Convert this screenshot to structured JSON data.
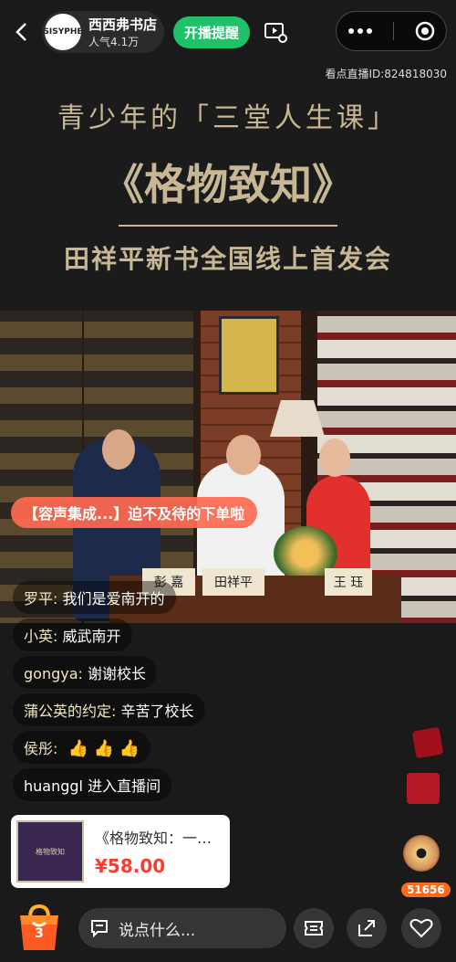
{
  "header": {
    "host_name": "西西弗书店",
    "host_popularity": "人气4.1万",
    "avatar_text": "SISYPHE",
    "notify_label": "开播提醒",
    "room_id": "看点直播ID:824818030"
  },
  "banner": {
    "line1": "青少年的「三堂人生课」",
    "line2": "《格物致知》",
    "line3": "田祥平新书全国线上首发会"
  },
  "scene": {
    "plate_left": "彭 嘉",
    "plate_center": "田祥平",
    "plate_right": "王 珏"
  },
  "promo": {
    "text": "【容声集成...】迫不及待的下单啦"
  },
  "comments": [
    {
      "name": "罗平:",
      "text": "我们是爱南开的"
    },
    {
      "name": "小英:",
      "text": "威武南开"
    },
    {
      "name": "gongya:",
      "text": "谢谢校长"
    },
    {
      "name": "蒲公英的约定:",
      "text": "辛苦了校长"
    },
    {
      "name": "侯彤:",
      "text": "👍 👍 👍"
    },
    {
      "name": "huanggl",
      "text": "进入直播间"
    }
  ],
  "product": {
    "title": "《格物致知：一…",
    "price": "¥58.00",
    "cover_text": "格物致知"
  },
  "likes_count": "51656",
  "bottom": {
    "cart_count": "3",
    "input_placeholder": "说点什么..."
  },
  "colors": {
    "accent_green": "#1fc16b",
    "promo": "#ff6950",
    "price": "#ff3b30",
    "banner_gold": "#c8b795"
  }
}
